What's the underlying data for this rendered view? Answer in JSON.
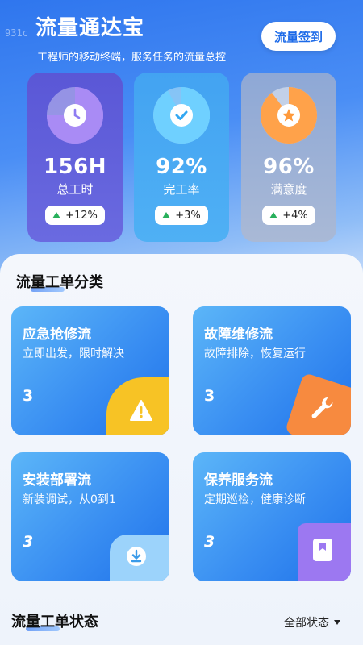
{
  "watermark": "931c",
  "header": {
    "title": "流量通达宝",
    "subtitle": "工程师的移动终端，服务任务的流量总控",
    "signin_label": "流量签到"
  },
  "stats": [
    {
      "value": "156H",
      "label": "总工时",
      "change": "+12%",
      "icon": "clock-icon",
      "color": "#8f7df2",
      "fill": 0.75
    },
    {
      "value": "92%",
      "label": "完工率",
      "change": "+3%",
      "icon": "check-icon",
      "color": "#5cc6ff",
      "fill": 0.92
    },
    {
      "value": "96%",
      "label": "满意度",
      "change": "+4%",
      "icon": "star-icon",
      "color": "#ffa24a",
      "fill": 0.96
    }
  ],
  "categories_section": {
    "title": "流量工单分类",
    "items": [
      {
        "title": "应急抢修流",
        "desc": "立即出发，限时解决",
        "count": "3",
        "icon": "warning-icon"
      },
      {
        "title": "故障维修流",
        "desc": "故障排除，恢复运行",
        "count": "3",
        "icon": "wrench-icon"
      },
      {
        "title": "安装部署流",
        "desc": "新装调试，从0到1",
        "count": "3",
        "icon": "download-icon"
      },
      {
        "title": "保养服务流",
        "desc": "定期巡检，健康诊断",
        "count": "3",
        "icon": "bookmark-icon"
      }
    ]
  },
  "status_section": {
    "title": "流量工单状态",
    "filter_label": "全部状态"
  }
}
